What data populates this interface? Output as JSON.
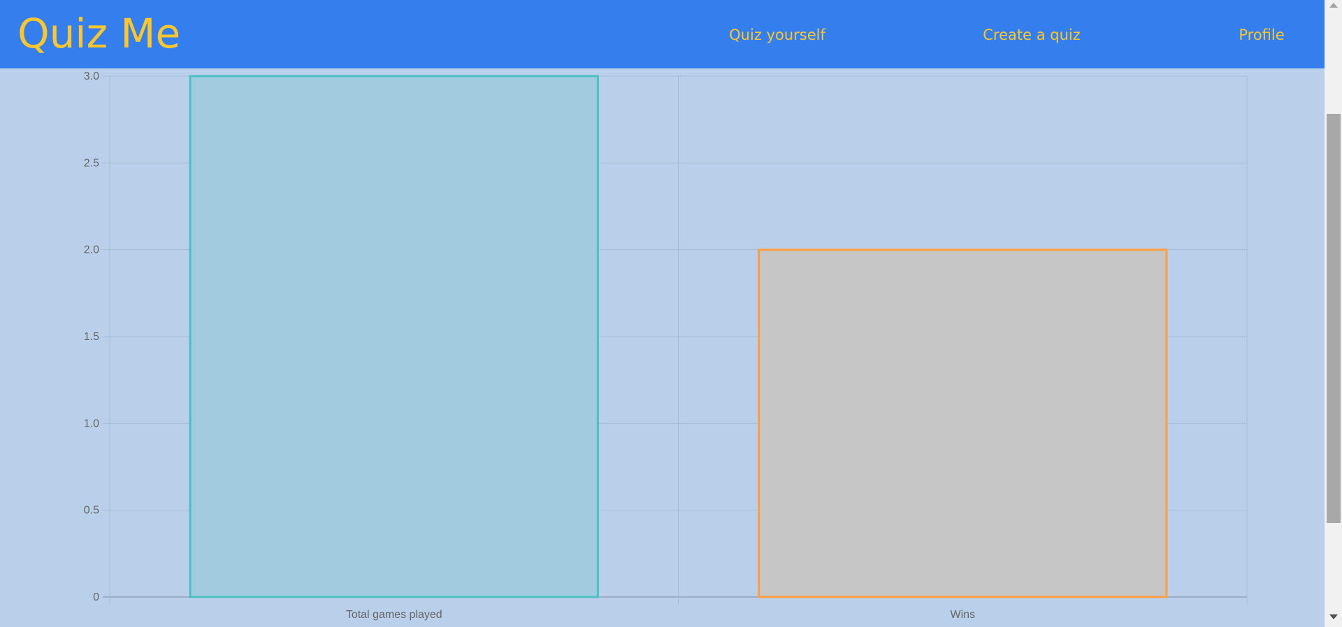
{
  "header": {
    "logo": "Quiz Me",
    "nav": [
      {
        "label": "Quiz yourself"
      },
      {
        "label": "Create a quiz"
      },
      {
        "label": "Profile"
      }
    ]
  },
  "colors": {
    "header": "#347eed",
    "accent": "#fcc72c",
    "background": "#bad0ea"
  },
  "chart_data": {
    "type": "bar",
    "categories": [
      "Total games played",
      "Wins"
    ],
    "values": [
      3,
      2
    ],
    "ylim": [
      0,
      3
    ],
    "yticks": [
      "0",
      "0.5",
      "1.0",
      "1.5",
      "2.0",
      "2.5",
      "3.0"
    ],
    "grid": true,
    "legend": "none",
    "bar_fills": [
      "#a3cbe0",
      "#c6c6c6"
    ],
    "bar_borders": [
      "#4bc0c0",
      "#ff9f40"
    ]
  }
}
